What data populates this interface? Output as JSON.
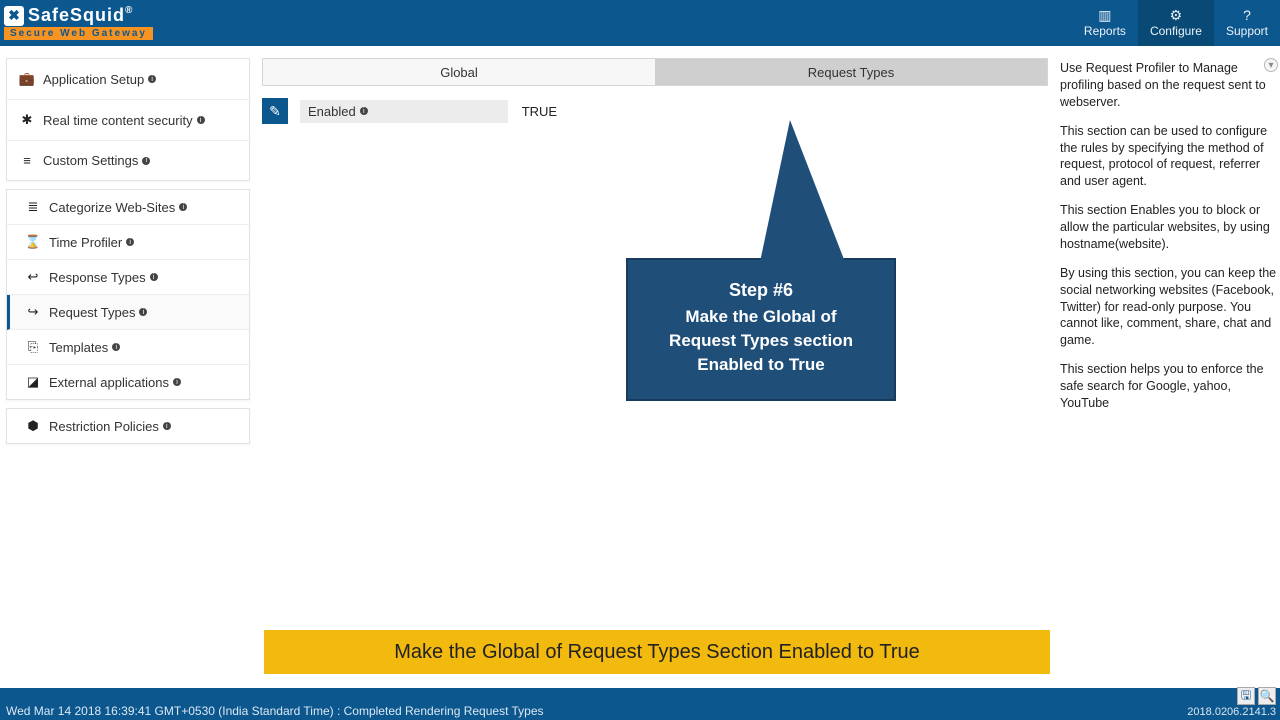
{
  "brand": {
    "name": "SafeSquid",
    "reg": "®",
    "tagline": "Secure Web Gateway",
    "logo_glyph": "✖"
  },
  "topnav": {
    "reports": "Reports",
    "configure": "Configure",
    "support": "Support"
  },
  "sidebar": {
    "app_setup": "Application Setup",
    "rt_security": "Real time content security",
    "custom": "Custom Settings",
    "sub": {
      "categorize": "Categorize Web-Sites",
      "time_profiler": "Time Profiler",
      "response_types": "Response Types",
      "request_types": "Request Types",
      "templates": "Templates",
      "external_apps": "External applications"
    },
    "restriction": "Restriction Policies"
  },
  "tabs": {
    "global": "Global",
    "request_types": "Request Types"
  },
  "global_row": {
    "label": "Enabled",
    "value": "TRUE",
    "edit_glyph": "✎"
  },
  "help": {
    "p1": "Use Request Profiler to Manage profiling based on the request sent to webserver.",
    "p2": "This section can be used to configure the rules by specifying the method of request, protocol of request, referrer and user agent.",
    "p3": "This section Enables you to block or allow the particular websites, by using hostname(website).",
    "p4": "By using this section, you can keep the social networking websites (Facebook, Twitter) for read-only purpose. You cannot like, comment, share, chat and game.",
    "p5": "This section helps you to enforce the safe search for Google, yahoo, YouTube"
  },
  "callout": {
    "title": "Step #6",
    "line1": "Make the Global of",
    "line2": "Request Types section",
    "line3": "Enabled to True"
  },
  "banner": "Make the Global of Request Types Section Enabled to True",
  "status": {
    "left": "Wed Mar 14 2018 16:39:41 GMT+0530 (India Standard Time) : Completed Rendering Request Types",
    "build": "2018.0206.2141.3",
    "save_glyph": "🖫",
    "search_glyph": "🔍"
  },
  "icons": {
    "reports": "▥",
    "configure": "⚙",
    "support": "?",
    "briefcase": "💼",
    "bug": "✱",
    "sliders": "≡",
    "db": "≣",
    "hourglass": "⌛",
    "back": "↩",
    "fwd": "↪",
    "template": "⎘",
    "ext": "◪",
    "shield": "⬢",
    "scroll": "▾"
  }
}
